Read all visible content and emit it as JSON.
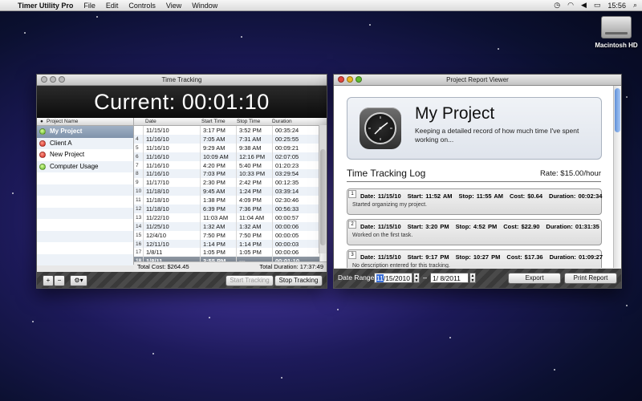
{
  "menubar": {
    "app": "Timer Utility Pro",
    "items": [
      "File",
      "Edit",
      "Controls",
      "View",
      "Window"
    ],
    "clock": "15:56"
  },
  "desktop": {
    "hd_label": "Macintosh HD"
  },
  "timer_window": {
    "title": "Time Tracking",
    "current": "Current: 00:01:10",
    "project_column": "Project Name",
    "projects": [
      {
        "name": "My Project",
        "status": "green",
        "selected": true
      },
      {
        "name": "Client A",
        "status": "red"
      },
      {
        "name": "New Project",
        "status": "red"
      },
      {
        "name": "Computer Usage",
        "status": "green"
      }
    ],
    "columns": [
      "Date",
      "Start Time",
      "Stop Time",
      "Duration"
    ],
    "rows": [
      {
        "n": "",
        "date": "11/15/10",
        "start": "3:17 PM",
        "stop": "3:52 PM",
        "dur": "00:35:24"
      },
      {
        "n": "4",
        "date": "11/16/10",
        "start": "7:05 AM",
        "stop": "7:31 AM",
        "dur": "00:25:55"
      },
      {
        "n": "5",
        "date": "11/16/10",
        "start": "9:29 AM",
        "stop": "9:38 AM",
        "dur": "00:09:21"
      },
      {
        "n": "6",
        "date": "11/16/10",
        "start": "10:09 AM",
        "stop": "12:16 PM",
        "dur": "02:07:05"
      },
      {
        "n": "7",
        "date": "11/16/10",
        "start": "4:20 PM",
        "stop": "5:40 PM",
        "dur": "01:20:23"
      },
      {
        "n": "8",
        "date": "11/16/10",
        "start": "7:03 PM",
        "stop": "10:33 PM",
        "dur": "03:29:54"
      },
      {
        "n": "9",
        "date": "11/17/10",
        "start": "2:30 PM",
        "stop": "2:42 PM",
        "dur": "00:12:35"
      },
      {
        "n": "10",
        "date": "11/18/10",
        "start": "9:45 AM",
        "stop": "1:24 PM",
        "dur": "03:39:14"
      },
      {
        "n": "11",
        "date": "11/18/10",
        "start": "1:38 PM",
        "stop": "4:09 PM",
        "dur": "02:30:46"
      },
      {
        "n": "12",
        "date": "11/18/10",
        "start": "6:39 PM",
        "stop": "7:36 PM",
        "dur": "00:56:33"
      },
      {
        "n": "13",
        "date": "11/22/10",
        "start": "11:03 AM",
        "stop": "11:04 AM",
        "dur": "00:00:57"
      },
      {
        "n": "14",
        "date": "11/25/10",
        "start": "1:32 AM",
        "stop": "1:32 AM",
        "dur": "00:00:06"
      },
      {
        "n": "15",
        "date": "12/4/10",
        "start": "7:50 PM",
        "stop": "7:50 PM",
        "dur": "00:00:05"
      },
      {
        "n": "16",
        "date": "12/11/10",
        "start": "1:14 PM",
        "stop": "1:14 PM",
        "dur": "00:00:03"
      },
      {
        "n": "17",
        "date": "1/8/11",
        "start": "1:05 PM",
        "stop": "1:05 PM",
        "dur": "00:00:06"
      },
      {
        "n": "18",
        "date": "1/8/11",
        "start": "3:55 PM",
        "stop": "---",
        "dur": "00:01:10",
        "selected": true
      }
    ],
    "total_cost": "Total Cost: $264.45",
    "total_duration": "Total Duration: 17:37:49",
    "add": "+",
    "remove": "−",
    "gear": "⚙▾",
    "start_btn": "Start Tracking",
    "stop_btn": "Stop Tracking"
  },
  "report_window": {
    "title": "Project Report Viewer",
    "project_name": "My Project",
    "description": "Keeping a detailed record of how much time I've spent working on...",
    "log_title": "Time Tracking Log",
    "rate": "Rate: $15.00/hour",
    "entries": [
      {
        "num": "1",
        "date": "Date: 11/15/10",
        "start": "Start: 11:52 AM",
        "stop": "Stop: 11:55 AM",
        "cost": "Cost: $0.64",
        "dur": "Duration: 00:02:34",
        "note": "Started organizing my project."
      },
      {
        "num": "2",
        "date": "Date: 11/15/10",
        "start": "Start: 3:20 PM",
        "stop": "Stop: 4:52 PM",
        "cost": "Cost: $22.90",
        "dur": "Duration: 01:31:35",
        "note": "Worked on the first task."
      },
      {
        "num": "3",
        "date": "Date: 11/15/10",
        "start": "Start: 9:17 PM",
        "stop": "Stop: 10:27 PM",
        "cost": "Cost: $17.36",
        "dur": "Duration: 01:09:27",
        "note": "No description entered for this tracking."
      }
    ],
    "date_range_label": "Date Range:",
    "from_month": "11",
    "from_rest": "/15/2010",
    "to_date": "1/ 8/2011",
    "dash": "–",
    "export": "Export",
    "print": "Print Report"
  },
  "colors": {
    "selection_blue": "#3a6fd8",
    "status_green": "#5ab220",
    "status_red": "#d0221a"
  }
}
